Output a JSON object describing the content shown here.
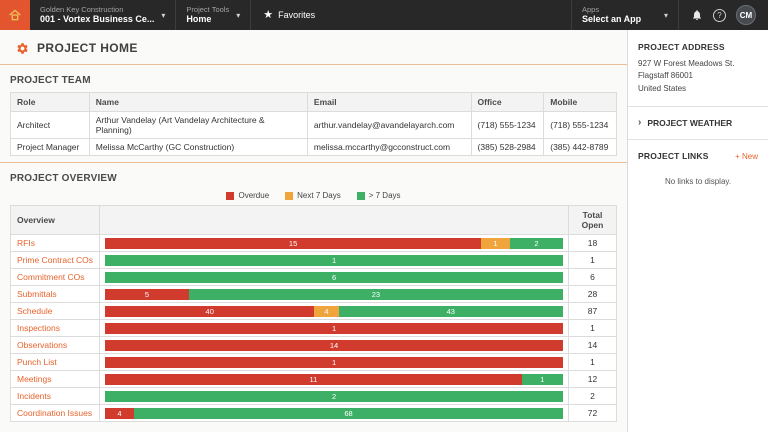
{
  "topbar": {
    "company": {
      "label": "Golden Key Construction",
      "value": "001 - Vortex Business Ce..."
    },
    "tools": {
      "label": "Project Tools",
      "value": "Home"
    },
    "favorites": "Favorites",
    "apps": {
      "label": "Apps",
      "value": "Select an App"
    },
    "avatar": "CM"
  },
  "page": {
    "title": "PROJECT HOME"
  },
  "project_team": {
    "title": "PROJECT TEAM",
    "columns": [
      "Role",
      "Name",
      "Email",
      "Office",
      "Mobile"
    ],
    "rows": [
      [
        "Architect",
        "Arthur Vandelay (Art Vandelay Architecture & Planning)",
        "arthur.vandelay@avandelayarch.com",
        "(718) 555-1234",
        "(718) 555-1234"
      ],
      [
        "Project Manager",
        "Melissa McCarthy (GC Construction)",
        "melissa.mccarthy@gcconstruct.com",
        "(385) 528-2984",
        "(385) 442-8789"
      ]
    ]
  },
  "project_overview": {
    "title": "PROJECT OVERVIEW",
    "header_overview": "Overview",
    "header_total": "Total Open",
    "legend": [
      {
        "label": "Overdue",
        "color": "#d03b2d"
      },
      {
        "label": "Next 7 Days",
        "color": "#f0a53c"
      },
      {
        "label": "> 7 Days",
        "color": "#3db066"
      }
    ],
    "rows": [
      {
        "label": "RFIs",
        "overdue": 15,
        "next7": 1,
        "later": 2,
        "total": 18
      },
      {
        "label": "Prime Contract COs",
        "overdue": 0,
        "next7": 0,
        "later": 1,
        "total": 1
      },
      {
        "label": "Commitment COs",
        "overdue": 0,
        "next7": 0,
        "later": 6,
        "total": 6
      },
      {
        "label": "Submittals",
        "overdue": 5,
        "next7": 0,
        "later": 23,
        "total": 28
      },
      {
        "label": "Schedule",
        "overdue": 40,
        "next7": 4,
        "later": 43,
        "total": 87
      },
      {
        "label": "Inspections",
        "overdue": 1,
        "next7": 0,
        "later": 0,
        "total": 1
      },
      {
        "label": "Observations",
        "overdue": 14,
        "next7": 0,
        "later": 0,
        "total": 14
      },
      {
        "label": "Punch List",
        "overdue": 1,
        "next7": 0,
        "later": 0,
        "total": 1
      },
      {
        "label": "Meetings",
        "overdue": 11,
        "next7": 0,
        "later": 1,
        "total": 12
      },
      {
        "label": "Incidents",
        "overdue": 0,
        "next7": 0,
        "later": 2,
        "total": 2
      },
      {
        "label": "Coordination Issues",
        "overdue": 4,
        "next7": 0,
        "later": 68,
        "total": 72
      }
    ]
  },
  "chart_data": {
    "type": "bar",
    "stacked": true,
    "orientation": "horizontal",
    "title": "PROJECT OVERVIEW",
    "categories": [
      "RFIs",
      "Prime Contract COs",
      "Commitment COs",
      "Submittals",
      "Schedule",
      "Inspections",
      "Observations",
      "Punch List",
      "Meetings",
      "Incidents",
      "Coordination Issues"
    ],
    "series": [
      {
        "name": "Overdue",
        "color": "#d03b2d",
        "values": [
          15,
          0,
          0,
          5,
          40,
          1,
          14,
          1,
          11,
          0,
          4
        ]
      },
      {
        "name": "Next 7 Days",
        "color": "#f0a53c",
        "values": [
          1,
          0,
          0,
          0,
          4,
          0,
          0,
          0,
          0,
          0,
          0
        ]
      },
      {
        "name": "> 7 Days",
        "color": "#3db066",
        "values": [
          2,
          1,
          6,
          23,
          43,
          0,
          0,
          0,
          1,
          2,
          68
        ]
      }
    ],
    "totals": [
      18,
      1,
      6,
      28,
      87,
      1,
      14,
      1,
      12,
      2,
      72
    ],
    "legend_position": "top"
  },
  "sidebar": {
    "address_title": "PROJECT ADDRESS",
    "address_lines": [
      "927 W Forest Meadows St.",
      "Flagstaff 86001",
      "United States"
    ],
    "weather_title": "PROJECT WEATHER",
    "links_title": "PROJECT LINKS",
    "new_link": "+ New",
    "no_links": "No links to display."
  },
  "colors": {
    "accent_orange": "#e8632c",
    "logo_orange": "#e2552f",
    "topbar_bg": "#282828",
    "overdue_red": "#d03b2d",
    "next7_yellow": "#f0a53c",
    "later_green": "#3db066"
  }
}
